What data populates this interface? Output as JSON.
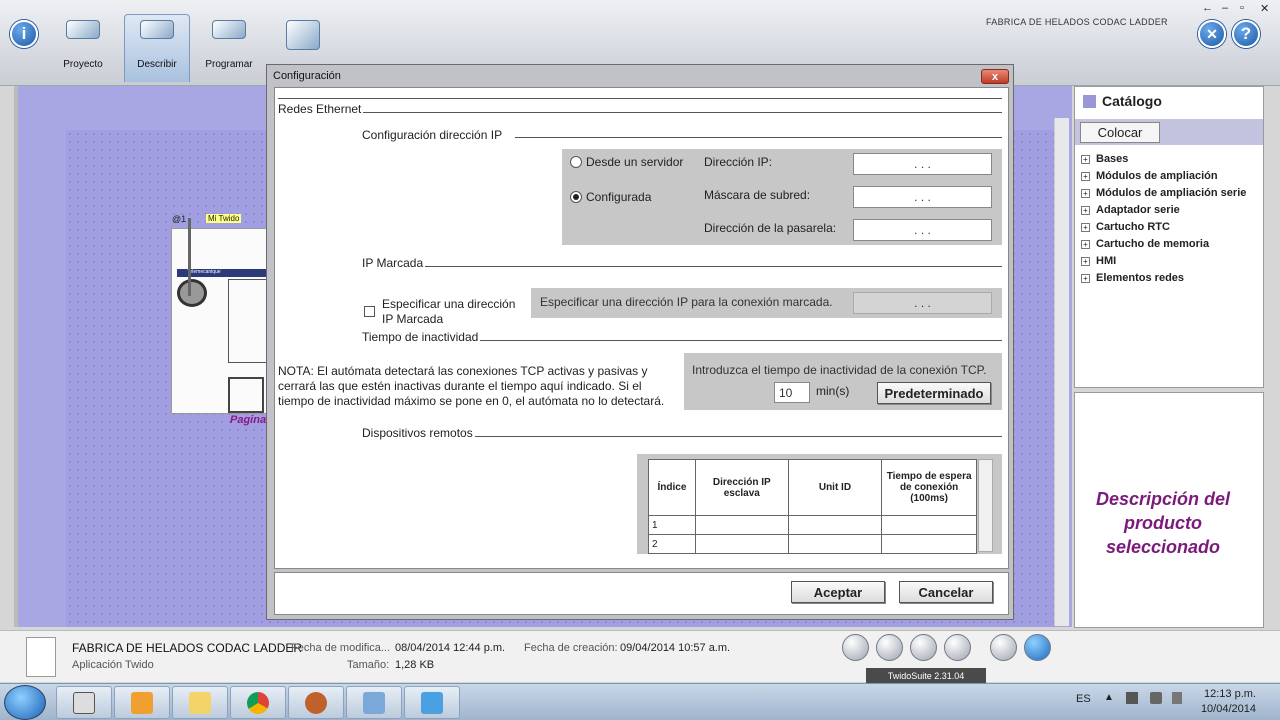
{
  "app": {
    "title": "FABRICA DE HELADOS CODAC LADDER",
    "window_controls": [
      "←",
      "–",
      "▫",
      "✕"
    ],
    "toolbar": [
      {
        "label": "Proyecto",
        "icon": "proyecto-icon"
      },
      {
        "label": "Describir",
        "icon": "describir-icon"
      },
      {
        "label": "Programar",
        "icon": "programar-icon"
      },
      {
        "label": "",
        "icon": "depurar-icon"
      }
    ],
    "info_btn": "i",
    "help_btn": "?"
  },
  "workspace": {
    "plc_label": "Mi Twido",
    "plc_addr": "@1",
    "plc_brand": "Telemecanique",
    "page_label": "Pagina"
  },
  "catalog": {
    "title": "Catálogo",
    "place_button": "Colocar",
    "items": [
      "Bases",
      "Módulos de ampliación",
      "Módulos de ampliación serie",
      "Adaptador serie",
      "Cartucho RTC",
      "Cartucho de memoria",
      "HMI",
      "Elementos redes"
    ],
    "description": "Descripción del producto seleccionado"
  },
  "dialog": {
    "title": "Configuración",
    "close": "x",
    "section_ethernet": "Redes Ethernet",
    "section_ip_config": "Configuración dirección IP",
    "radio_server": "Desde un servidor",
    "radio_configured": "Configurada",
    "ip_label": "Dirección IP:",
    "mask_label": "Máscara de subred:",
    "gateway_label": "Dirección de la pasarela:",
    "ip_placeholder": ".     .     .",
    "section_dialed": "IP Marcada",
    "dialed_checkbox_label_1": "Especificar una dirección",
    "dialed_checkbox_label_2": "IP Marcada",
    "dialed_hint": "Especificar una dirección IP para la conexión marcada.",
    "section_timeout": "Tiempo de inactividad",
    "note": "NOTA: El autómata detectará las conexiones TCP activas y pasivas y cerrará las que estén inactivas durante el tiempo aquí indicado. Si el tiempo de inactividad máximo se pone en 0, el autómata no lo detectará.",
    "timeout_prompt": "Introduzca el tiempo de inactividad de la conexión TCP.",
    "timeout_value": "10",
    "timeout_unit": "min(s)",
    "default_button": "Predeterminado",
    "section_remote": "Dispositivos remotos",
    "table_headers": [
      "Índice",
      "Dirección IP esclava",
      "Unit ID",
      "Tiempo de espera de conexión (100ms)"
    ],
    "table_rows": [
      [
        "1",
        "",
        "",
        ""
      ],
      [
        "2",
        "",
        "",
        ""
      ]
    ],
    "accept": "Aceptar",
    "cancel": "Cancelar"
  },
  "infobar": {
    "project": "FABRICA DE HELADOS CODAC LADDER",
    "app_type": "Aplicación Twido",
    "modified_label": "Fecha de modifica...",
    "modified_value": "08/04/2014 12:44 p.m.",
    "created_label": "Fecha de creación:",
    "created_value": "09/04/2014 10:57 a.m.",
    "size_label": "Tamaño:",
    "size_value": "1,28 KB",
    "version": "TwidoSuite 2.31.04"
  },
  "taskbar": {
    "lang": "ES",
    "time": "12:13 p.m.",
    "date": "10/04/2014",
    "apps": [
      "calculator-icon",
      "media-player-icon",
      "file-explorer-icon",
      "chrome-icon",
      "baseball-glove-icon",
      "twidosuite-icon",
      "remote-desktop-icon"
    ]
  }
}
